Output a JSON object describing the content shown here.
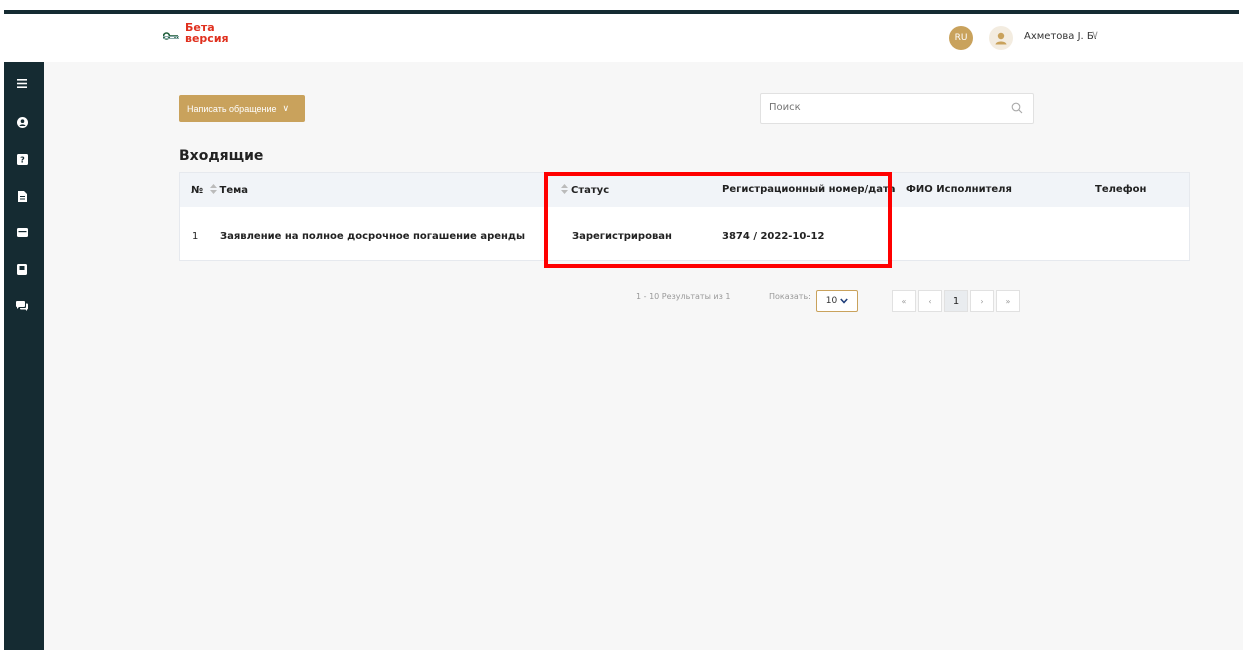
{
  "header": {
    "beta_line1": "Бета",
    "beta_line2": "версия",
    "lang": "RU",
    "user_name": "Ахметова J. Б.",
    "user_chevron": "∨"
  },
  "sidebar": {
    "items": [
      {
        "icon": "menu-icon"
      },
      {
        "icon": "user-icon"
      },
      {
        "icon": "question-icon"
      },
      {
        "icon": "document-icon"
      },
      {
        "icon": "card-icon"
      },
      {
        "icon": "folder-icon"
      },
      {
        "icon": "chat-icon"
      }
    ]
  },
  "toolbar": {
    "write_label": "Написать обращение",
    "write_chevron": "∨",
    "search_placeholder": "Поиск"
  },
  "inbox": {
    "title": "Входящие",
    "columns": {
      "num": "№",
      "topic": "Тема",
      "status": "Статус",
      "reg": "Регистрационный номер/дата",
      "executor": "ФИО Исполнителя",
      "phone": "Телефон"
    },
    "rows": [
      {
        "num": "1",
        "topic": "Заявление на полное досрочное погашение аренды",
        "status": "Зарегистрирован",
        "reg": "3874 / 2022-10-12",
        "executor": "",
        "phone": ""
      }
    ]
  },
  "pagination": {
    "results": "1 - 10 Результаты из 1",
    "show_label": "Показать:",
    "per_page": "10",
    "first": "«",
    "prev": "‹",
    "current": "1",
    "next": "›",
    "last": "»"
  },
  "colors": {
    "accent": "#c9a25c",
    "sidebar": "#152b32",
    "highlight": "#ff0000",
    "beta": "#e0301e"
  }
}
